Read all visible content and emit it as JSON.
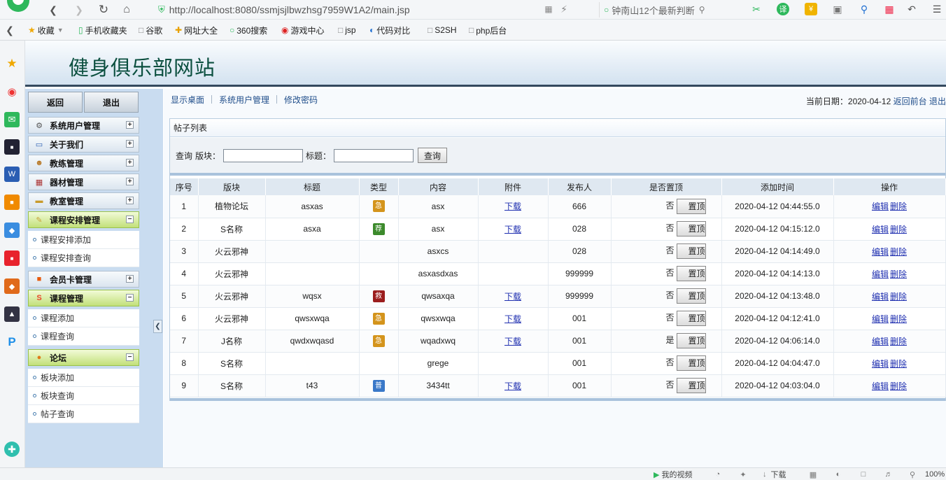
{
  "browser": {
    "url": "http://localhost:8080/ssmjsjlbwzhsg7959W1A2/main.jsp",
    "search_text": "钟南山12个最新判断",
    "bookmarks": [
      "收藏",
      "手机收藏夹",
      "谷歌",
      "网址大全",
      "360搜索",
      "游戏中心",
      "jsp",
      "代码对比",
      "S2SH",
      "php后台"
    ],
    "status_items": [
      "我的视频",
      "下载",
      "100%"
    ]
  },
  "app": {
    "title": "健身俱乐部网站"
  },
  "sidebar": {
    "back_label": "返回",
    "logout_label": "退出",
    "menus": [
      {
        "label": "系统用户管理",
        "icon": "gear-icon",
        "open": false
      },
      {
        "label": "关于我们",
        "icon": "monitor-icon",
        "open": false
      },
      {
        "label": "教练管理",
        "icon": "person-icon",
        "open": false
      },
      {
        "label": "器材管理",
        "icon": "calendar-icon",
        "open": false
      },
      {
        "label": "教室管理",
        "icon": "folder-icon",
        "open": false
      },
      {
        "label": "课程安排管理",
        "icon": "notepad-icon",
        "open": true,
        "items": [
          "课程安排添加",
          "课程安排查询"
        ]
      },
      {
        "label": "会员卡管理",
        "icon": "taobao-icon",
        "open": false
      },
      {
        "label": "课程管理",
        "icon": "s-logo-icon",
        "open": true,
        "items": [
          "课程添加",
          "课程查询"
        ]
      },
      {
        "label": "论坛",
        "icon": "forum-icon",
        "open": true,
        "items": [
          "板块添加",
          "板块查询",
          "帖子查询"
        ]
      }
    ]
  },
  "nav": {
    "tabs": [
      "显示桌面",
      "系统用户管理",
      "修改密码"
    ],
    "date_label": "当前日期：2020-04-12",
    "front_link": "返回前台",
    "logout_link": "退出"
  },
  "panel": {
    "title": "帖子列表",
    "search": {
      "prefix": "查询",
      "section_label": "版块：",
      "title_label": "标题：",
      "section_value": "",
      "title_value": "",
      "button": "查询"
    }
  },
  "table": {
    "headers": [
      "序号",
      "版块",
      "标题",
      "类型",
      "内容",
      "附件",
      "发布人",
      "是否置顶",
      "添加时间",
      "操作"
    ],
    "pin_button": "置顶",
    "edit_label": "编辑",
    "delete_label": "删除",
    "rows": [
      {
        "no": "1",
        "section": "植物论坛",
        "title": "asxas",
        "type": "急",
        "type_color": "#d4941c",
        "content": "asx",
        "attach": "下载",
        "author": "666",
        "pinned": "否",
        "time": "2020-04-12 04:44:55.0"
      },
      {
        "no": "2",
        "section": "S名称",
        "title": "asxa",
        "type": "荐",
        "type_color": "#3c8a2c",
        "content": "asx",
        "attach": "下载",
        "author": "028",
        "pinned": "否",
        "time": "2020-04-12 04:15:12.0"
      },
      {
        "no": "3",
        "section": "火云邪神",
        "title": "",
        "type": "",
        "type_color": "",
        "content": "asxcs",
        "attach": "",
        "author": "028",
        "pinned": "否",
        "time": "2020-04-12 04:14:49.0"
      },
      {
        "no": "4",
        "section": "火云邪神",
        "title": "",
        "type": "",
        "type_color": "",
        "content": "asxasdxas",
        "attach": "",
        "author": "999999",
        "pinned": "否",
        "time": "2020-04-12 04:14:13.0"
      },
      {
        "no": "5",
        "section": "火云邪神",
        "title": "wqsx",
        "type": "救",
        "type_color": "#9b1d1d",
        "content": "qwsaxqa",
        "attach": "下载",
        "author": "999999",
        "pinned": "否",
        "time": "2020-04-12 04:13:48.0"
      },
      {
        "no": "6",
        "section": "火云邪神",
        "title": "qwsxwqa",
        "type": "急",
        "type_color": "#d4941c",
        "content": "qwsxwqa",
        "attach": "下载",
        "author": "001",
        "pinned": "否",
        "time": "2020-04-12 04:12:41.0"
      },
      {
        "no": "7",
        "section": "J名称",
        "title": "qwdxwqasd",
        "type": "急",
        "type_color": "#d4941c",
        "content": "wqadxwq",
        "attach": "下载",
        "author": "001",
        "pinned": "是",
        "time": "2020-04-12 04:06:14.0"
      },
      {
        "no": "8",
        "section": "S名称",
        "title": "",
        "type": "",
        "type_color": "",
        "content": "grege",
        "attach": "",
        "author": "001",
        "pinned": "否",
        "time": "2020-04-12 04:04:47.0"
      },
      {
        "no": "9",
        "section": "S名称",
        "title": "t43",
        "type": "普",
        "type_color": "#3a78c8",
        "content": "3434tt",
        "attach": "下载",
        "author": "001",
        "pinned": "否",
        "time": "2020-04-12 04:03:04.0"
      }
    ]
  }
}
